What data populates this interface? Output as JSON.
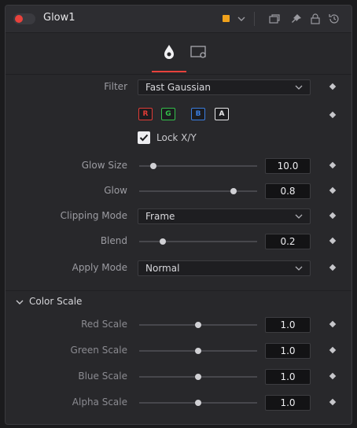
{
  "header": {
    "title": "Glow1",
    "accent_color": "#f0a21c",
    "toggle_color": "#e8423c"
  },
  "tabs": [
    {
      "name": "controls",
      "icon": "droplet-icon"
    },
    {
      "name": "settings",
      "icon": "settings-gear-icon"
    }
  ],
  "controls": {
    "filter": {
      "label": "Filter",
      "value": "Fast Gaussian"
    },
    "channels": [
      "R",
      "G",
      "B",
      "A"
    ],
    "lock_xy": {
      "label": "Lock X/Y",
      "checked": true
    },
    "glow_size": {
      "label": "Glow Size",
      "value": "10.0",
      "fraction": 0.12
    },
    "glow": {
      "label": "Glow",
      "value": "0.8",
      "fraction": 0.8
    },
    "clipping_mode": {
      "label": "Clipping Mode",
      "value": "Frame"
    },
    "blend": {
      "label": "Blend",
      "value": "0.2",
      "fraction": 0.2
    },
    "apply_mode": {
      "label": "Apply Mode",
      "value": "Normal"
    }
  },
  "color_scale": {
    "title": "Color Scale",
    "red": {
      "label": "Red Scale",
      "value": "1.0",
      "fraction": 0.5
    },
    "green": {
      "label": "Green Scale",
      "value": "1.0",
      "fraction": 0.5
    },
    "blue": {
      "label": "Blue Scale",
      "value": "1.0",
      "fraction": 0.5
    },
    "alpha": {
      "label": "Alpha Scale",
      "value": "1.0",
      "fraction": 0.5
    }
  }
}
